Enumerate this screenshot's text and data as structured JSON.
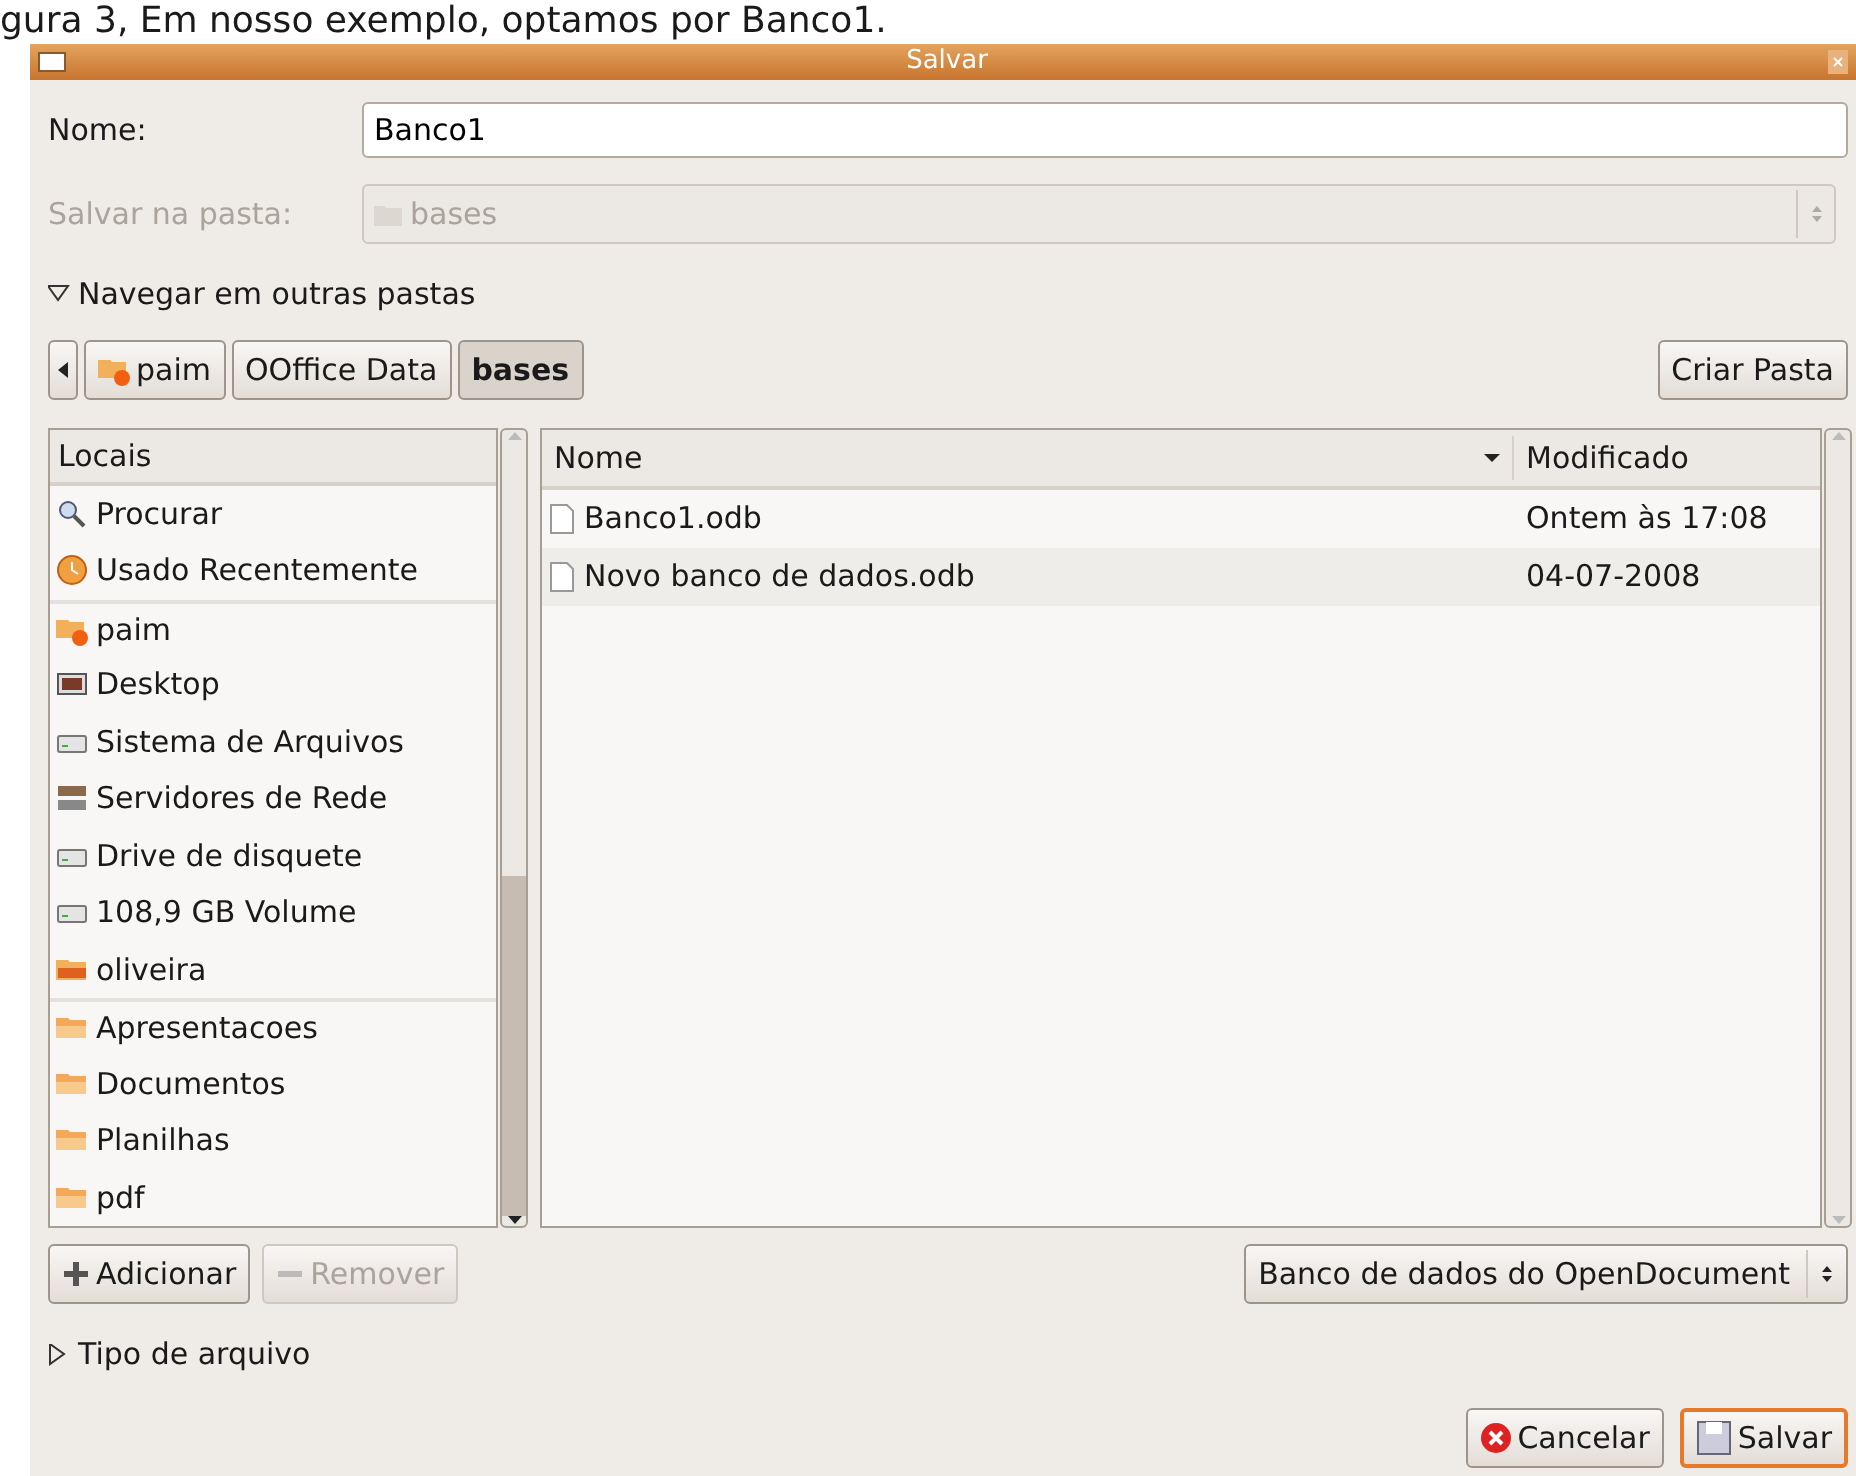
{
  "caption": "gura 3, Em nosso exemplo, optamos por Banco1.",
  "window": {
    "title": "Salvar"
  },
  "name_field": {
    "label": "Nome:",
    "value": "Banco1"
  },
  "folder_field": {
    "label": "Salvar na pasta:",
    "value": "bases",
    "disabled": true
  },
  "browse_toggle": {
    "label": "Navegar em outras pastas",
    "expanded": true
  },
  "path_bar": [
    {
      "label": "paim",
      "kind": "home",
      "selected": false
    },
    {
      "label": "OOffice Data",
      "kind": "plain",
      "selected": false
    },
    {
      "label": "bases",
      "kind": "plain",
      "selected": true
    }
  ],
  "create_folder_button": "Criar Pasta",
  "places": {
    "heading": "Locais",
    "sections": [
      [
        {
          "label": "Procurar",
          "kind": "search"
        },
        {
          "label": "Usado Recentemente",
          "kind": "recent"
        }
      ],
      [
        {
          "label": "paim",
          "kind": "home"
        },
        {
          "label": "Desktop",
          "kind": "desktop"
        },
        {
          "label": "Sistema de Arquivos",
          "kind": "drive"
        },
        {
          "label": "Servidores de Rede",
          "kind": "network"
        },
        {
          "label": "Drive de disquete",
          "kind": "drive"
        },
        {
          "label": "108,9 GB Volume",
          "kind": "drive"
        },
        {
          "label": "oliveira",
          "kind": "share"
        }
      ],
      [
        {
          "label": "Apresentacoes",
          "kind": "folder"
        },
        {
          "label": "Documentos",
          "kind": "folder"
        },
        {
          "label": "Planilhas",
          "kind": "folder"
        },
        {
          "label": "pdf",
          "kind": "folder"
        }
      ]
    ]
  },
  "files": {
    "columns": [
      "Nome",
      "Modificado"
    ],
    "rows": [
      {
        "name": "Banco1.odb",
        "modified": "Ontem às 17:08"
      },
      {
        "name": "Novo banco de dados.odb",
        "modified": "04-07-2008"
      }
    ]
  },
  "add_button": {
    "label": "Adicionar",
    "disabled": false
  },
  "remove_button": {
    "label": "Remover",
    "disabled": true
  },
  "filter_select": "Banco de dados do OpenDocument",
  "type_toggle": {
    "label": "Tipo de arquivo",
    "expanded": false
  },
  "cancel_button": "Cancelar",
  "save_button": "Salvar"
}
